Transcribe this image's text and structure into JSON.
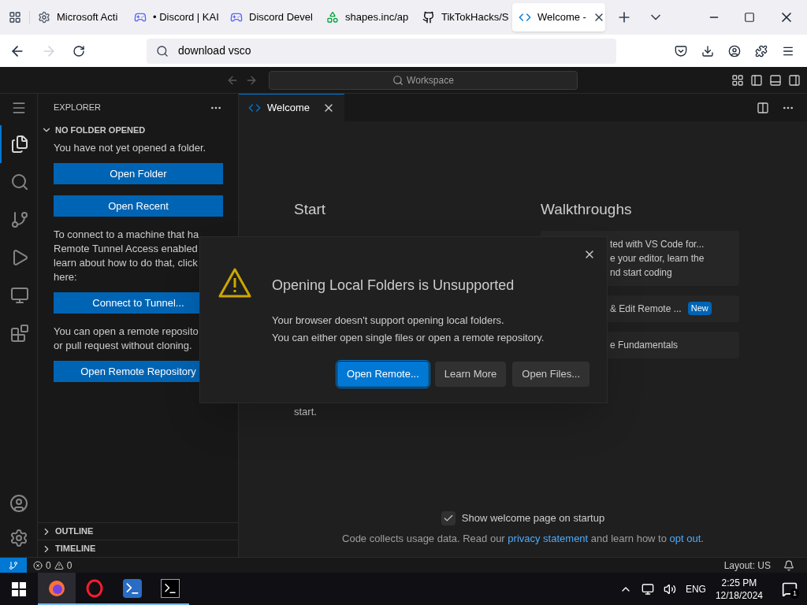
{
  "browser": {
    "tabs": [
      {
        "title": "Microsoft Acti",
        "kind": "gear",
        "selected": false
      },
      {
        "title": "• Discord | KAI",
        "kind": "discord-alert",
        "selected": false
      },
      {
        "title": "Discord Devel",
        "kind": "discord",
        "selected": false
      },
      {
        "title": "shapes.inc/ap",
        "kind": "shapes",
        "selected": false
      },
      {
        "title": "TikTokHacks/S",
        "kind": "github",
        "selected": false
      },
      {
        "title": "Welcome -",
        "kind": "vscode",
        "selected": true
      }
    ],
    "address": {
      "value": "download vsco"
    }
  },
  "vscode": {
    "search": {
      "placeholder": "Workspace"
    },
    "activity_bar": [
      {
        "kind": "files",
        "selected": true
      },
      {
        "kind": "search",
        "selected": false
      },
      {
        "kind": "source-control",
        "selected": false
      },
      {
        "kind": "run",
        "selected": false
      },
      {
        "kind": "remote",
        "selected": false
      },
      {
        "kind": "extensions",
        "selected": false
      }
    ],
    "sidebar": {
      "title": "EXPLORER",
      "section": {
        "title": "NO FOLDER OPENED",
        "expanded": true
      },
      "blocks": [
        {
          "kind": "text",
          "lines": [
            "You have not yet opened a folder."
          ]
        },
        {
          "kind": "button",
          "label": "Open Folder"
        },
        {
          "kind": "button",
          "label": "Open Recent"
        },
        {
          "kind": "text",
          "lines": [
            "To connect to a machine that ha",
            "Remote Tunnel Access enabled",
            "learn about how to do that, click",
            "here:"
          ]
        },
        {
          "kind": "button",
          "label": "Connect to Tunnel..."
        },
        {
          "kind": "text",
          "lines": [
            "You can open a remote reposito",
            "or pull request without cloning."
          ]
        },
        {
          "kind": "button",
          "label": "Open Remote Repository"
        }
      ],
      "collapsed": [
        {
          "title": "OUTLINE",
          "expanded": false
        },
        {
          "title": "TIMELINE",
          "expanded": false
        }
      ]
    },
    "editor_tab": {
      "title": "Welcome"
    },
    "welcome": {
      "start_title": "Start",
      "start_tail": "start.",
      "walkthroughs_title": "Walkthroughs",
      "walkthroughs": [
        {
          "lines": [
            "ted with VS Code for...",
            "e your editor, learn the",
            "nd start coding"
          ]
        },
        {
          "lines": [
            "& Edit Remote ..."
          ],
          "badge": "New"
        },
        {
          "lines": [
            "e Fundamentals"
          ]
        }
      ],
      "show_on_startup": {
        "label": "Show welcome page on startup",
        "checked": true
      },
      "footer": {
        "text1": "Code collects usage data. Read our",
        "link1": "privacy statement",
        "text2": "and learn how to",
        "link2": "opt out",
        "text3": "."
      }
    },
    "dialog": {
      "title": "Opening Local Folders is Unsupported",
      "message_lines": [
        "Your browser doesn't support opening local folders.",
        "You can either open single files or open a remote repository."
      ],
      "buttons": [
        {
          "label": "Open Remote...",
          "primary": true
        },
        {
          "label": "Learn More",
          "primary": false
        },
        {
          "label": "Open Files...",
          "primary": false
        }
      ]
    },
    "status_bar": {
      "errors": "0",
      "warnings": "0",
      "layout": "Layout: US"
    }
  },
  "taskbar": {
    "apps": [
      {
        "kind": "firefox",
        "selected": true
      },
      {
        "kind": "opera",
        "selected": false
      },
      {
        "kind": "powershell",
        "selected": false
      },
      {
        "kind": "terminal",
        "selected": false
      }
    ],
    "language": "ENG",
    "time": "2:25 PM",
    "date": "12/18/2024",
    "notifications": "1"
  }
}
